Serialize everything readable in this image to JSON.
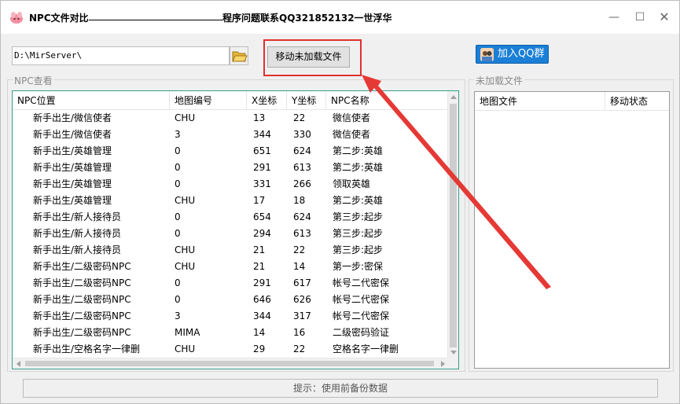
{
  "window": {
    "title": "NPC文件对比",
    "title_right": "程序问题联系QQ321852132一世浮华",
    "controls": {
      "minimize": "—",
      "maximize": "☐",
      "close": "✕"
    }
  },
  "toolbar": {
    "path_value": "D:\\MirServer\\",
    "move_button_label": "移动未加载文件",
    "qq_button_label": "加入QQ群"
  },
  "npc_panel": {
    "group_label": "NPC查看",
    "columns": [
      "NPC位置",
      "地图编号",
      "X坐标",
      "Y坐标",
      "NPC名称"
    ],
    "rows": [
      [
        "新手出生/微信使者",
        "CHU",
        "13",
        "22",
        "微信使者"
      ],
      [
        "新手出生/微信使者",
        "3",
        "344",
        "330",
        "微信使者"
      ],
      [
        "新手出生/英雄管理",
        "0",
        "651",
        "624",
        "第二步:英雄"
      ],
      [
        "新手出生/英雄管理",
        "0",
        "291",
        "613",
        "第二步:英雄"
      ],
      [
        "新手出生/英雄管理",
        "0",
        "331",
        "266",
        "领取英雄"
      ],
      [
        "新手出生/英雄管理",
        "CHU",
        "17",
        "18",
        "第二步:英雄"
      ],
      [
        "新手出生/新人接待员",
        "0",
        "654",
        "624",
        "第三步:起步"
      ],
      [
        "新手出生/新人接待员",
        "0",
        "294",
        "613",
        "第三步:起步"
      ],
      [
        "新手出生/新人接待员",
        "CHU",
        "21",
        "22",
        "第三步:起步"
      ],
      [
        "新手出生/二级密码NPC",
        "CHU",
        "21",
        "14",
        "第一步:密保"
      ],
      [
        "新手出生/二级密码NPC",
        "0",
        "291",
        "617",
        "帐号二代密保"
      ],
      [
        "新手出生/二级密码NPC",
        "0",
        "646",
        "626",
        "帐号二代密保"
      ],
      [
        "新手出生/二级密码NPC",
        "3",
        "344",
        "317",
        "帐号二代密保"
      ],
      [
        "新手出生/二级密码NPC",
        "MIMA",
        "14",
        "16",
        "二级密码验证"
      ],
      [
        "新手出生/空格名字一律删",
        "CHU",
        "29",
        "22",
        "空格名字一律删"
      ]
    ]
  },
  "unload_panel": {
    "group_label": "未加载文件",
    "columns": [
      "地图文件",
      "移动状态"
    ]
  },
  "status": {
    "text": "提示：使用前备份数据"
  },
  "colors": {
    "list_border": "#3a9e8a",
    "qq_button": "#1a7fd6",
    "annotation_red": "#e03030"
  },
  "icons": {
    "app": "app-logo-icon",
    "folder": "folder-open-icon",
    "qq": "qq-avatar-icon"
  }
}
